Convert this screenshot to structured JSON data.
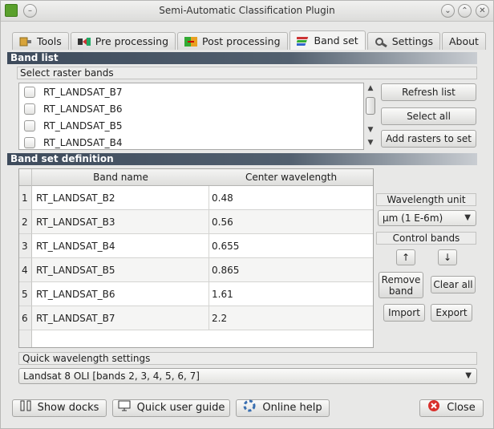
{
  "window": {
    "title": "Semi-Automatic Classification Plugin"
  },
  "tabs": [
    {
      "label": "Tools",
      "icon": "tools-icon"
    },
    {
      "label": "Pre processing",
      "icon": "pre-processing-icon"
    },
    {
      "label": "Post processing",
      "icon": "post-processing-icon"
    },
    {
      "label": "Band set",
      "icon": "band-set-icon",
      "active": true
    },
    {
      "label": "Settings",
      "icon": "settings-icon"
    },
    {
      "label": "About"
    }
  ],
  "band_list": {
    "header": "Band list",
    "select_label": "Select raster bands",
    "items": [
      "RT_LANDSAT_B7",
      "RT_LANDSAT_B6",
      "RT_LANDSAT_B5",
      "RT_LANDSAT_B4"
    ],
    "refresh_label": "Refresh list",
    "select_all_label": "Select all",
    "add_label": "Add rasters to set"
  },
  "band_set": {
    "header": "Band set definition",
    "columns": [
      "Band name",
      "Center wavelength"
    ],
    "rows": [
      {
        "num": "1",
        "name": "RT_LANDSAT_B2",
        "wavelength": "0.48"
      },
      {
        "num": "2",
        "name": "RT_LANDSAT_B3",
        "wavelength": "0.56"
      },
      {
        "num": "3",
        "name": "RT_LANDSAT_B4",
        "wavelength": "0.655"
      },
      {
        "num": "4",
        "name": "RT_LANDSAT_B5",
        "wavelength": "0.865"
      },
      {
        "num": "5",
        "name": "RT_LANDSAT_B6",
        "wavelength": "1.61"
      },
      {
        "num": "6",
        "name": "RT_LANDSAT_B7",
        "wavelength": "2.2"
      }
    ],
    "wavelength_unit_label": "Wavelength unit",
    "wavelength_unit_value": "µm (1 E-6m)",
    "control_bands_label": "Control bands",
    "remove_band_label_1": "Remove",
    "remove_band_label_2": "band",
    "clear_all_label": "Clear all",
    "import_label": "Import",
    "export_label": "Export"
  },
  "quick": {
    "label": "Quick wavelength settings",
    "value": "Landsat 8 OLI [bands 2, 3, 4, 5, 6, 7]"
  },
  "footer": {
    "show_docks": "Show docks",
    "quick_guide": "Quick user guide",
    "online_help": "Online help",
    "close": "Close"
  },
  "colors": {
    "section_header": "#3e4b5c",
    "close_icon": "#d9302c",
    "app_icon": "#5aa02c"
  }
}
